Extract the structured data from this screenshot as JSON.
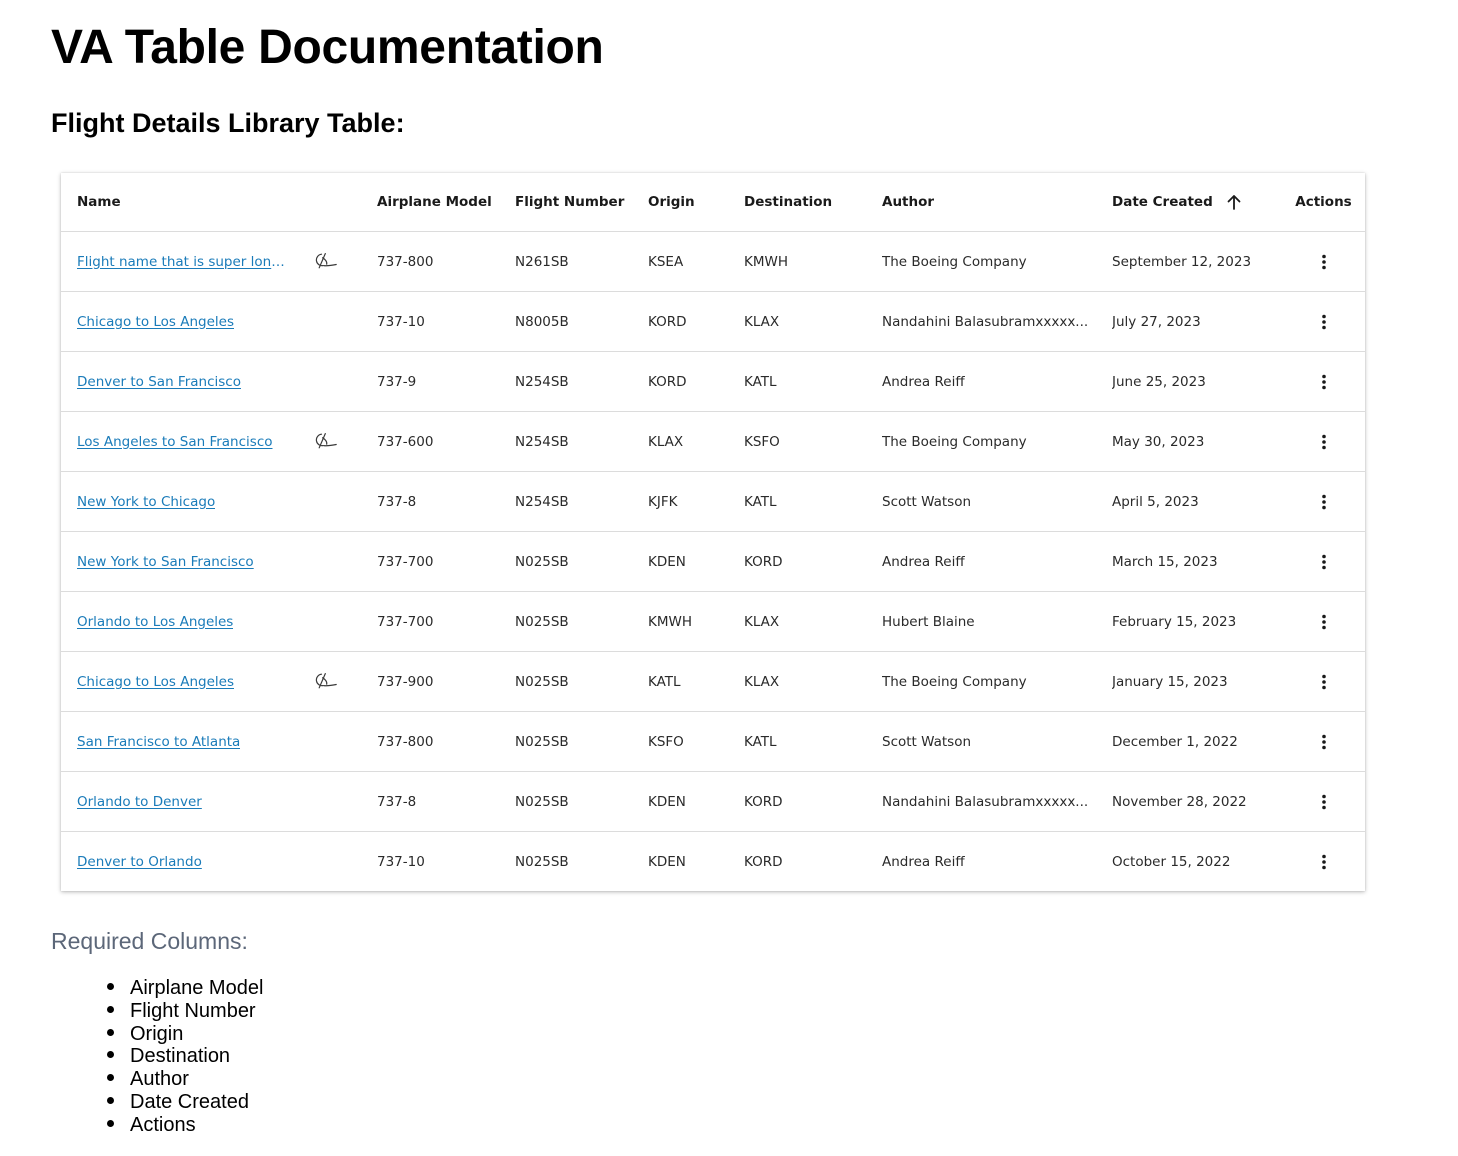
{
  "page": {
    "title": "VA Table Documentation",
    "section_title": "Flight Details Library Table:"
  },
  "table": {
    "columns": [
      "Name",
      "Airplane Model",
      "Flight Number",
      "Origin",
      "Destination",
      "Author",
      "Date Created",
      "Actions"
    ],
    "sort_column": "Date Created",
    "sort_direction": "ascending",
    "link_color": "#1a7bb9",
    "rows": [
      {
        "name": "Flight name that is super long...",
        "logo": true,
        "model": "737-800",
        "flight_number": "N261SB",
        "origin": "KSEA",
        "destination": "KMWH",
        "author": "The Boeing Company",
        "date": "September 12, 2023"
      },
      {
        "name": "Chicago to Los Angeles",
        "logo": false,
        "model": "737-10",
        "flight_number": "N8005B",
        "origin": "KORD",
        "destination": "KLAX",
        "author": "Nandahini Balasubramxxxxx...",
        "date": "July 27, 2023"
      },
      {
        "name": "Denver to San Francisco",
        "logo": false,
        "model": "737-9",
        "flight_number": "N254SB",
        "origin": "KORD",
        "destination": "KATL",
        "author": "Andrea Reiff",
        "date": "June 25, 2023"
      },
      {
        "name": "Los Angeles to San Francisco",
        "logo": true,
        "model": "737-600",
        "flight_number": "N254SB",
        "origin": "KLAX",
        "destination": "KSFO",
        "author": "The Boeing Company",
        "date": "May 30, 2023"
      },
      {
        "name": "New York to Chicago",
        "logo": false,
        "model": "737-8",
        "flight_number": "N254SB",
        "origin": "KJFK",
        "destination": "KATL",
        "author": "Scott Watson",
        "date": "April 5, 2023"
      },
      {
        "name": "New York to San Francisco",
        "logo": false,
        "model": "737-700",
        "flight_number": "N025SB",
        "origin": "KDEN",
        "destination": "KORD",
        "author": "Andrea Reiff",
        "date": "March 15, 2023"
      },
      {
        "name": "Orlando to Los Angeles",
        "logo": false,
        "model": "737-700",
        "flight_number": "N025SB",
        "origin": "KMWH",
        "destination": "KLAX",
        "author": "Hubert Blaine",
        "date": "February 15, 2023"
      },
      {
        "name": "Chicago to Los Angeles",
        "logo": true,
        "model": "737-900",
        "flight_number": "N025SB",
        "origin": "KATL",
        "destination": "KLAX",
        "author": "The Boeing Company",
        "date": "January 15, 2023"
      },
      {
        "name": "San Francisco to Atlanta",
        "logo": false,
        "model": "737-800",
        "flight_number": "N025SB",
        "origin": "KSFO",
        "destination": "KATL",
        "author": "Scott Watson",
        "date": "December 1, 2022"
      },
      {
        "name": "Orlando to Denver",
        "logo": false,
        "model": "737-8",
        "flight_number": "N025SB",
        "origin": "KDEN",
        "destination": "KORD",
        "author": "Nandahini Balasubramxxxxx...",
        "date": "November 28, 2022"
      },
      {
        "name": "Denver to Orlando",
        "logo": false,
        "model": "737-10",
        "flight_number": "N025SB",
        "origin": "KDEN",
        "destination": "KORD",
        "author": "Andrea Reiff",
        "date": "October 15, 2022"
      }
    ]
  },
  "icons": {
    "row_logo": "boeing-logo-icon",
    "sort": "arrow-up-icon",
    "row_action": "more-vertical-icon"
  },
  "required": {
    "title": "Required Columns:",
    "items": [
      "Airplane Model",
      "Flight Number",
      "Origin",
      "Destination",
      "Author",
      "Date Created",
      "Actions"
    ]
  }
}
